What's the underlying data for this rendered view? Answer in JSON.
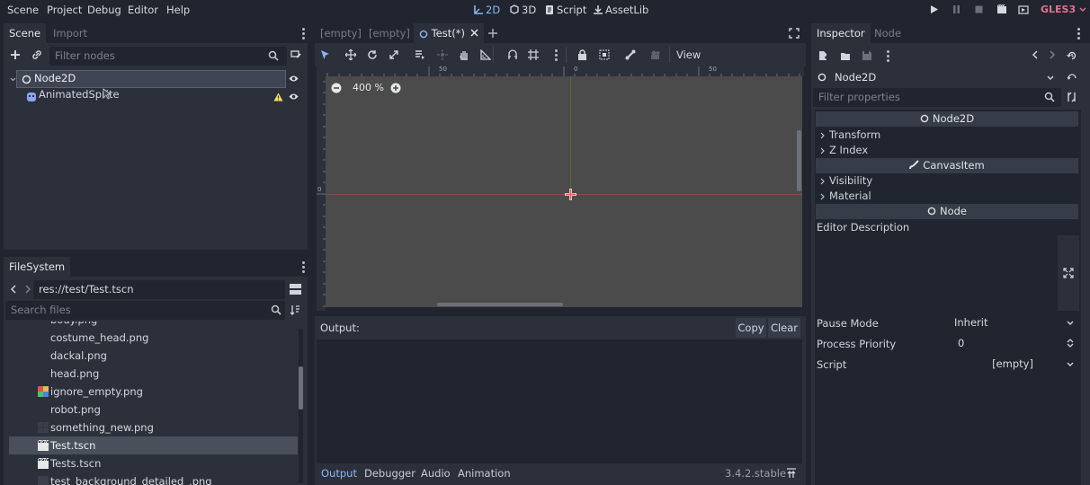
{
  "menu": [
    "Scene",
    "Project",
    "Debug",
    "Editor",
    "Help"
  ],
  "modes": {
    "m2d": "2D",
    "m3d": "3D",
    "script": "Script",
    "assetlib": "AssetLib"
  },
  "renderer": "GLES3",
  "scene_dock": {
    "tabs": {
      "scene": "Scene",
      "import": "Import"
    },
    "filter_placeholder": "Filter nodes",
    "nodes": [
      {
        "name": "Node2D",
        "icon": "node2d-circle-icon"
      },
      {
        "name": "AnimatedSprite",
        "icon": "animated-sprite-icon",
        "warning": true
      }
    ]
  },
  "filesystem": {
    "tab": "FileSystem",
    "path": "res://test/Test.tscn",
    "search_placeholder": "Search files",
    "files": [
      {
        "name": "body.png",
        "icon": "none"
      },
      {
        "name": "costume_head.png",
        "icon": "none"
      },
      {
        "name": "dackal.png",
        "icon": "none"
      },
      {
        "name": "head.png",
        "icon": "none"
      },
      {
        "name": "ignore_empty.png",
        "icon": "color-image"
      },
      {
        "name": "robot.png",
        "icon": "none"
      },
      {
        "name": "something_new.png",
        "icon": "dark-image"
      },
      {
        "name": "Test.tscn",
        "icon": "clapper",
        "selected": true
      },
      {
        "name": "Tests.tscn",
        "icon": "clapper"
      },
      {
        "name": "test_background_detailed_.png",
        "icon": "dark-image"
      }
    ]
  },
  "editor_tabs": [
    "[empty]",
    "[empty]",
    "Test(*)"
  ],
  "viewport": {
    "view_label": "View",
    "zoom": "400 %",
    "ruler_top": [
      "50",
      "0",
      "50"
    ],
    "ruler_left": "0"
  },
  "output": {
    "label": "Output:",
    "copy": "Copy",
    "clear": "Clear",
    "bottom_tabs": [
      "Output",
      "Debugger",
      "Audio",
      "Animation"
    ],
    "version": "3.4.2.stable"
  },
  "inspector": {
    "tabs": {
      "inspector": "Inspector",
      "node": "Node"
    },
    "object": "Node2D",
    "filter_placeholder": "Filter properties",
    "sections": {
      "node2d": "Node2D",
      "canvas_item": "CanvasItem",
      "node": "Node"
    },
    "groups": {
      "transform": "Transform",
      "zindex": "Z Index",
      "visibility": "Visibility",
      "material": "Material"
    },
    "editor_description": "Editor Description",
    "props": {
      "pause_mode": {
        "label": "Pause Mode",
        "value": "Inherit"
      },
      "process_priority": {
        "label": "Process Priority",
        "value": "0"
      },
      "script": {
        "label": "Script",
        "value": "[empty]"
      }
    }
  },
  "colors": {
    "accent": "#8db6f4",
    "panel": "#2b303b",
    "bg": "#21252f",
    "viewport": "#4b4b4b",
    "renderer": "#e66f8f"
  }
}
